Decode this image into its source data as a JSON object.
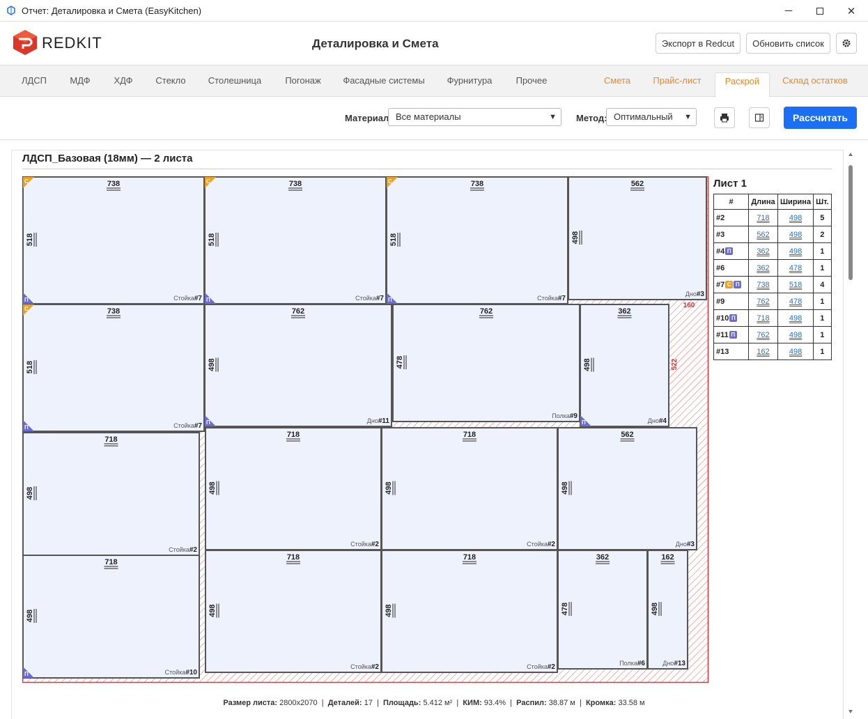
{
  "window": {
    "title": "Отчет: Деталировка и Смета (EasyKitchen)"
  },
  "header": {
    "brand": "REDKIT",
    "title": "Деталировка и Смета",
    "export_label": "Экспорт в Redcut",
    "refresh_label": "Обновить список"
  },
  "tabs": [
    "ЛДСП",
    "МДФ",
    "ХДФ",
    "Стекло",
    "Столешница",
    "Погонаж",
    "Фасадные системы",
    "Фурнитура",
    "Прочее"
  ],
  "right_tabs": [
    "Смета",
    "Прайс-лист",
    "Раскрой",
    "Склад остатков"
  ],
  "active_tab": "Раскрой",
  "toolbar": {
    "material_label": "Материал:",
    "material_value": "Все материалы",
    "method_label": "Метод:",
    "method_value": "Оптимальный",
    "calc_label": "Рассчитать"
  },
  "section": {
    "title": "ЛДСП_Базовая (18мм) — 2 листа"
  },
  "sheet": {
    "label": "Лист 1",
    "waste_labels": [
      "160",
      "522"
    ],
    "parts": [
      {
        "len": "738",
        "wid": "518",
        "name": "Стойка",
        "no": "#7",
        "c": true,
        "p": true
      },
      {
        "len": "738",
        "wid": "518",
        "name": "Стойка",
        "no": "#7",
        "c": true,
        "p": true
      },
      {
        "len": "738",
        "wid": "518",
        "name": "Стойка",
        "no": "#7",
        "c": true,
        "p": true
      },
      {
        "len": "562",
        "wid": "498",
        "name": "Дно",
        "no": "#3",
        "c": false,
        "p": false
      },
      {
        "len": "738",
        "wid": "518",
        "name": "Стойка",
        "no": "#7",
        "c": true,
        "p": true
      },
      {
        "len": "762",
        "wid": "498",
        "name": "Дно",
        "no": "#11",
        "c": false,
        "p": true
      },
      {
        "len": "762",
        "wid": "478",
        "name": "Полка",
        "no": "#9",
        "c": false,
        "p": false
      },
      {
        "len": "362",
        "wid": "498",
        "name": "Дно",
        "no": "#4",
        "c": false,
        "p": true
      },
      {
        "len": "718",
        "wid": "498",
        "name": "Стойка",
        "no": "#2",
        "c": false,
        "p": false
      },
      {
        "len": "718",
        "wid": "498",
        "name": "Стойка",
        "no": "#2",
        "c": false,
        "p": false
      },
      {
        "len": "718",
        "wid": "498",
        "name": "Стойка",
        "no": "#2",
        "c": false,
        "p": false
      },
      {
        "len": "562",
        "wid": "498",
        "name": "Дно",
        "no": "#3",
        "c": false,
        "p": false
      },
      {
        "len": "718",
        "wid": "498",
        "name": "Стойка",
        "no": "#10",
        "c": false,
        "p": true
      },
      {
        "len": "718",
        "wid": "498",
        "name": "Стойка",
        "no": "#2",
        "c": false,
        "p": false
      },
      {
        "len": "718",
        "wid": "498",
        "name": "Стойка",
        "no": "#2",
        "c": false,
        "p": false
      },
      {
        "len": "362",
        "wid": "478",
        "name": "Полка",
        "no": "#6",
        "c": false,
        "p": false
      },
      {
        "len": "162",
        "wid": "498",
        "name": "Дно",
        "no": "#13",
        "c": false,
        "p": false
      }
    ]
  },
  "table": {
    "headers": [
      "#",
      "Длина",
      "Ширина",
      "Шт."
    ],
    "rows": [
      {
        "id": "#2",
        "c": false,
        "p": false,
        "len": "718",
        "wid": "498",
        "qty": "5"
      },
      {
        "id": "#3",
        "c": false,
        "p": false,
        "len": "562",
        "wid": "498",
        "qty": "2"
      },
      {
        "id": "#4",
        "c": false,
        "p": true,
        "len": "362",
        "wid": "498",
        "qty": "1"
      },
      {
        "id": "#6",
        "c": false,
        "p": false,
        "len": "362",
        "wid": "478",
        "qty": "1"
      },
      {
        "id": "#7",
        "c": true,
        "p": true,
        "len": "738",
        "wid": "518",
        "qty": "4"
      },
      {
        "id": "#9",
        "c": false,
        "p": false,
        "len": "762",
        "wid": "478",
        "qty": "1"
      },
      {
        "id": "#10",
        "c": false,
        "p": true,
        "len": "718",
        "wid": "498",
        "qty": "1"
      },
      {
        "id": "#11",
        "c": false,
        "p": true,
        "len": "762",
        "wid": "498",
        "qty": "1"
      },
      {
        "id": "#13",
        "c": false,
        "p": false,
        "len": "162",
        "wid": "498",
        "qty": "1"
      }
    ]
  },
  "badges": {
    "c": "С",
    "p": "П"
  },
  "summary": {
    "size_label": "Размер листа:",
    "size": "2800x2070",
    "parts_label": "Деталей:",
    "parts": "17",
    "area_label": "Площадь:",
    "area": "5.412 м²",
    "kim_label": "КИМ:",
    "kim": "93.4%",
    "cut_label": "Распил:",
    "cut": "38.87 м",
    "edge_label": "Кромка:",
    "edge": "33.58 м"
  }
}
